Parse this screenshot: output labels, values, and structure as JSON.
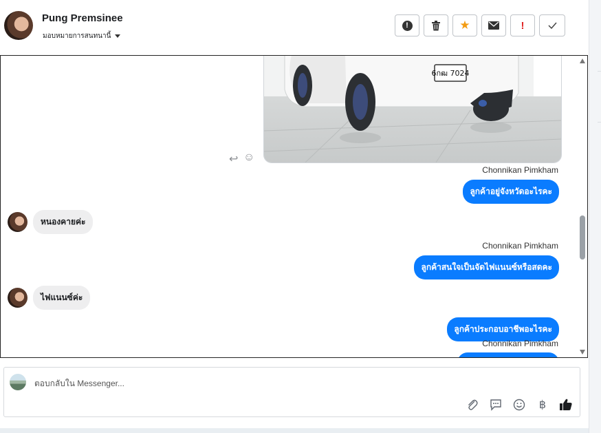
{
  "header": {
    "contact_name": "Pung Premsinee",
    "assign_label": "มอบหมายการสนทนานี้"
  },
  "toolbar": {
    "buttons": [
      "spam-icon",
      "trash-icon",
      "star-icon",
      "envelope-icon",
      "exclamation-icon",
      "check-icon"
    ]
  },
  "photo": {
    "plate_text": "6กฒ 7024"
  },
  "messages": [
    {
      "from": "Chonnikan Pimkham",
      "direction": "out",
      "text": "ลูกค้าอยู่จังหวัดอะไรคะ"
    },
    {
      "direction": "in",
      "text": "หนองคายค่ะ"
    },
    {
      "from": "Chonnikan Pimkham",
      "direction": "out",
      "text": "ลูกค้าสนใจเป็นจัดไฟแนนซ์หรือสดคะ"
    },
    {
      "direction": "in",
      "text": "ไฟแนนซ์ค่ะ"
    },
    {
      "direction": "out",
      "text": "ลูกค้าประกอบอาชีพอะไรคะ"
    },
    {
      "from": "Chonnikan Pimkham",
      "direction": "out",
      "text": ""
    }
  ],
  "composer": {
    "placeholder": "ตอบกลับใน Messenger...",
    "tools": [
      "paperclip-icon",
      "saved-reply-icon",
      "emoji-icon",
      "baht-icon",
      "thumbs-up-icon"
    ],
    "baht_symbol": "฿"
  },
  "colors": {
    "outgoing_bubble": "#0a7cff",
    "incoming_bubble": "#eeeeef",
    "star": "#f39c12",
    "alert": "#e02424"
  }
}
